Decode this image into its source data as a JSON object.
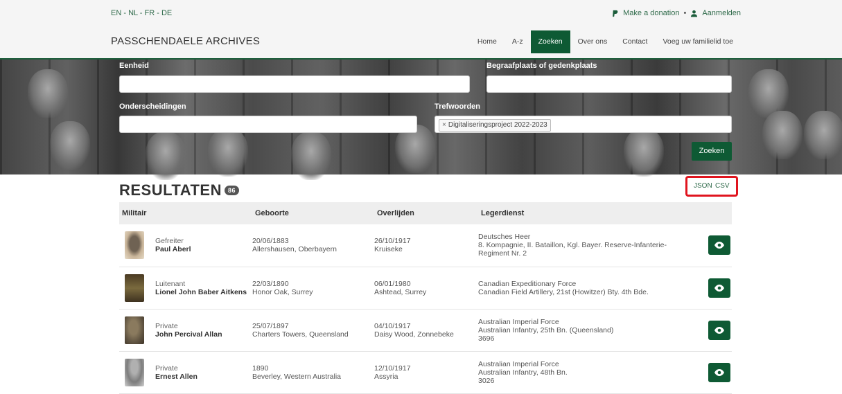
{
  "languages": [
    "EN",
    "NL",
    "FR",
    "DE"
  ],
  "top_links": {
    "donate": "Make a donation",
    "login": "Aanmelden",
    "separator": "•"
  },
  "brand": "PASSCHENDAELE ARCHIVES",
  "nav": [
    {
      "label": "Home",
      "active": false
    },
    {
      "label": "A-z",
      "active": false
    },
    {
      "label": "Zoeken",
      "active": true
    },
    {
      "label": "Over ons",
      "active": false
    },
    {
      "label": "Contact",
      "active": false
    },
    {
      "label": "Voeg uw familielid toe",
      "active": false
    }
  ],
  "filters": {
    "eenheid": {
      "label": "Eenheid",
      "value": ""
    },
    "begraafplaats": {
      "label": "Begraafplaats of gedenkplaats",
      "value": ""
    },
    "onderscheidingen": {
      "label": "Onderscheidingen",
      "value": ""
    },
    "trefwoorden": {
      "label": "Trefwoorden",
      "tag": "Digitaliseringsproject 2022-2023",
      "remove": "×"
    },
    "search_button": "Zoeken"
  },
  "results": {
    "title": "RESULTATEN",
    "count": "86",
    "export": {
      "json": "JSON",
      "csv": "CSV"
    },
    "columns": [
      "Militair",
      "Geboorte",
      "Overlijden",
      "Legerdienst"
    ],
    "rows": [
      {
        "rank": "Gefreiter",
        "name": "Paul Aberl",
        "birth_date": "20/06/1883",
        "birth_place": "Allershausen, Oberbayern",
        "death_date": "26/10/1917",
        "death_place": "Kruiseke",
        "service": [
          "Deutsches Heer",
          "8. Kompagnie, II. Bataillon, Kgl. Bayer. Reserve-Infanterie-",
          "Regiment Nr. 2"
        ]
      },
      {
        "rank": "Luitenant",
        "name": "Lionel John Baber Aitkens",
        "birth_date": "22/03/1890",
        "birth_place": "Honor Oak, Surrey",
        "death_date": "06/01/1980",
        "death_place": "Ashtead, Surrey",
        "service": [
          "Canadian Expeditionary Force",
          "Canadian Field Artillery, 21st (Howitzer) Bty. 4th Bde."
        ]
      },
      {
        "rank": "Private",
        "name": "John Percival Allan",
        "birth_date": "25/07/1897",
        "birth_place": "Charters Towers, Queensland",
        "death_date": "04/10/1917",
        "death_place": "Daisy Wood, Zonnebeke",
        "service": [
          "Australian Imperial Force",
          "Australian Infantry, 25th Bn. (Queensland)",
          "3696"
        ]
      },
      {
        "rank": "Private",
        "name": "Ernest Allen",
        "birth_date": "1890",
        "birth_place": "Beverley, Western Australia",
        "death_date": "12/10/1917",
        "death_place": "Assyria",
        "service": [
          "Australian Imperial Force",
          "Australian Infantry, 48th Bn.",
          "3026"
        ]
      }
    ]
  },
  "colors": {
    "accent": "#0e5a34",
    "link": "#2f6a4a",
    "highlight": "#e0141e"
  }
}
